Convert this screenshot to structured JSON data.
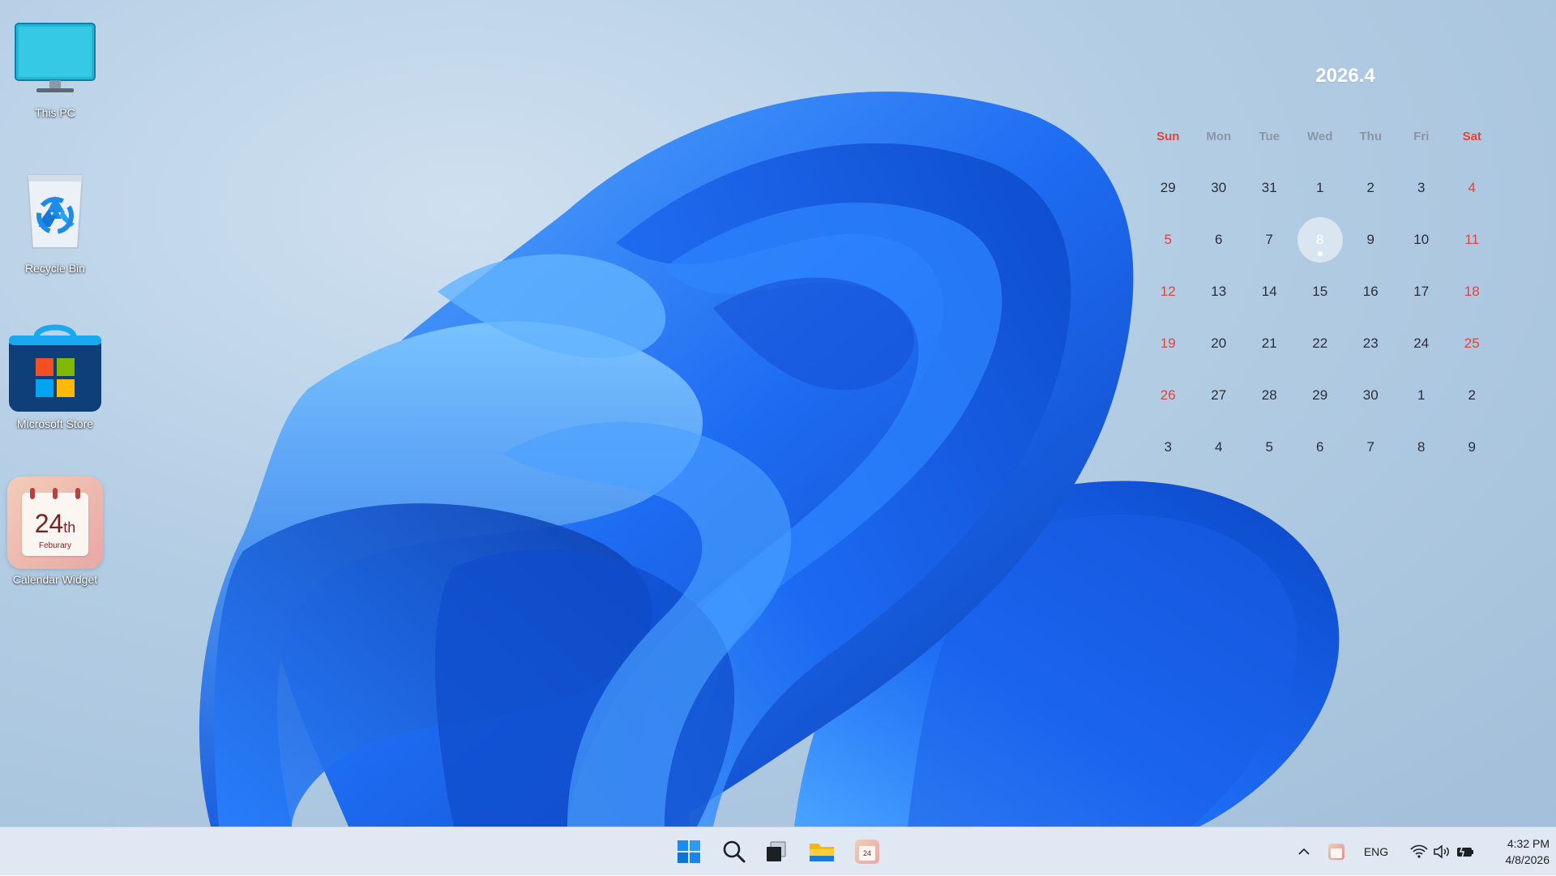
{
  "desktop_icons": [
    {
      "label": "This PC",
      "icon": "monitor-icon"
    },
    {
      "label": "Recycle Bin",
      "icon": "recycle-bin-icon"
    },
    {
      "label": "Microsoft Store",
      "icon": "store-bag-icon"
    },
    {
      "label": "Calendar Widget",
      "icon": "calendar-widget-icon",
      "badge_day": "24",
      "badge_suffix": "th",
      "badge_month": "Feburary"
    }
  ],
  "calendar": {
    "title": "2026.4",
    "weekdays": [
      "Sun",
      "Mon",
      "Tue",
      "Wed",
      "Thu",
      "Fri",
      "Sat"
    ],
    "weeks": [
      [
        "29",
        "30",
        "31",
        "1",
        "2",
        "3",
        "4"
      ],
      [
        "5",
        "6",
        "7",
        "8",
        "9",
        "10",
        "11"
      ],
      [
        "12",
        "13",
        "14",
        "15",
        "16",
        "17",
        "18"
      ],
      [
        "19",
        "20",
        "21",
        "22",
        "23",
        "24",
        "25"
      ],
      [
        "26",
        "27",
        "28",
        "29",
        "30",
        "1",
        "2"
      ],
      [
        "3",
        "4",
        "5",
        "6",
        "7",
        "8",
        "9"
      ]
    ],
    "today": "8",
    "weekend_color": "#e0443a"
  },
  "taskbar": {
    "pinned": [
      {
        "name": "start",
        "icon": "windows-logo-icon"
      },
      {
        "name": "search",
        "icon": "search-icon"
      },
      {
        "name": "task-view",
        "icon": "task-view-icon"
      },
      {
        "name": "file-explorer",
        "icon": "folder-icon"
      },
      {
        "name": "calendar-widget",
        "icon": "calendar-widget-icon",
        "badge": "24"
      }
    ],
    "tray": {
      "chevron": "^",
      "language": "ENG",
      "time": "4:32 PM",
      "date": "4/8/2026"
    }
  },
  "colors": {
    "accent_blue": "#1f6cff",
    "taskbar_bg": "#dfe8f3"
  }
}
